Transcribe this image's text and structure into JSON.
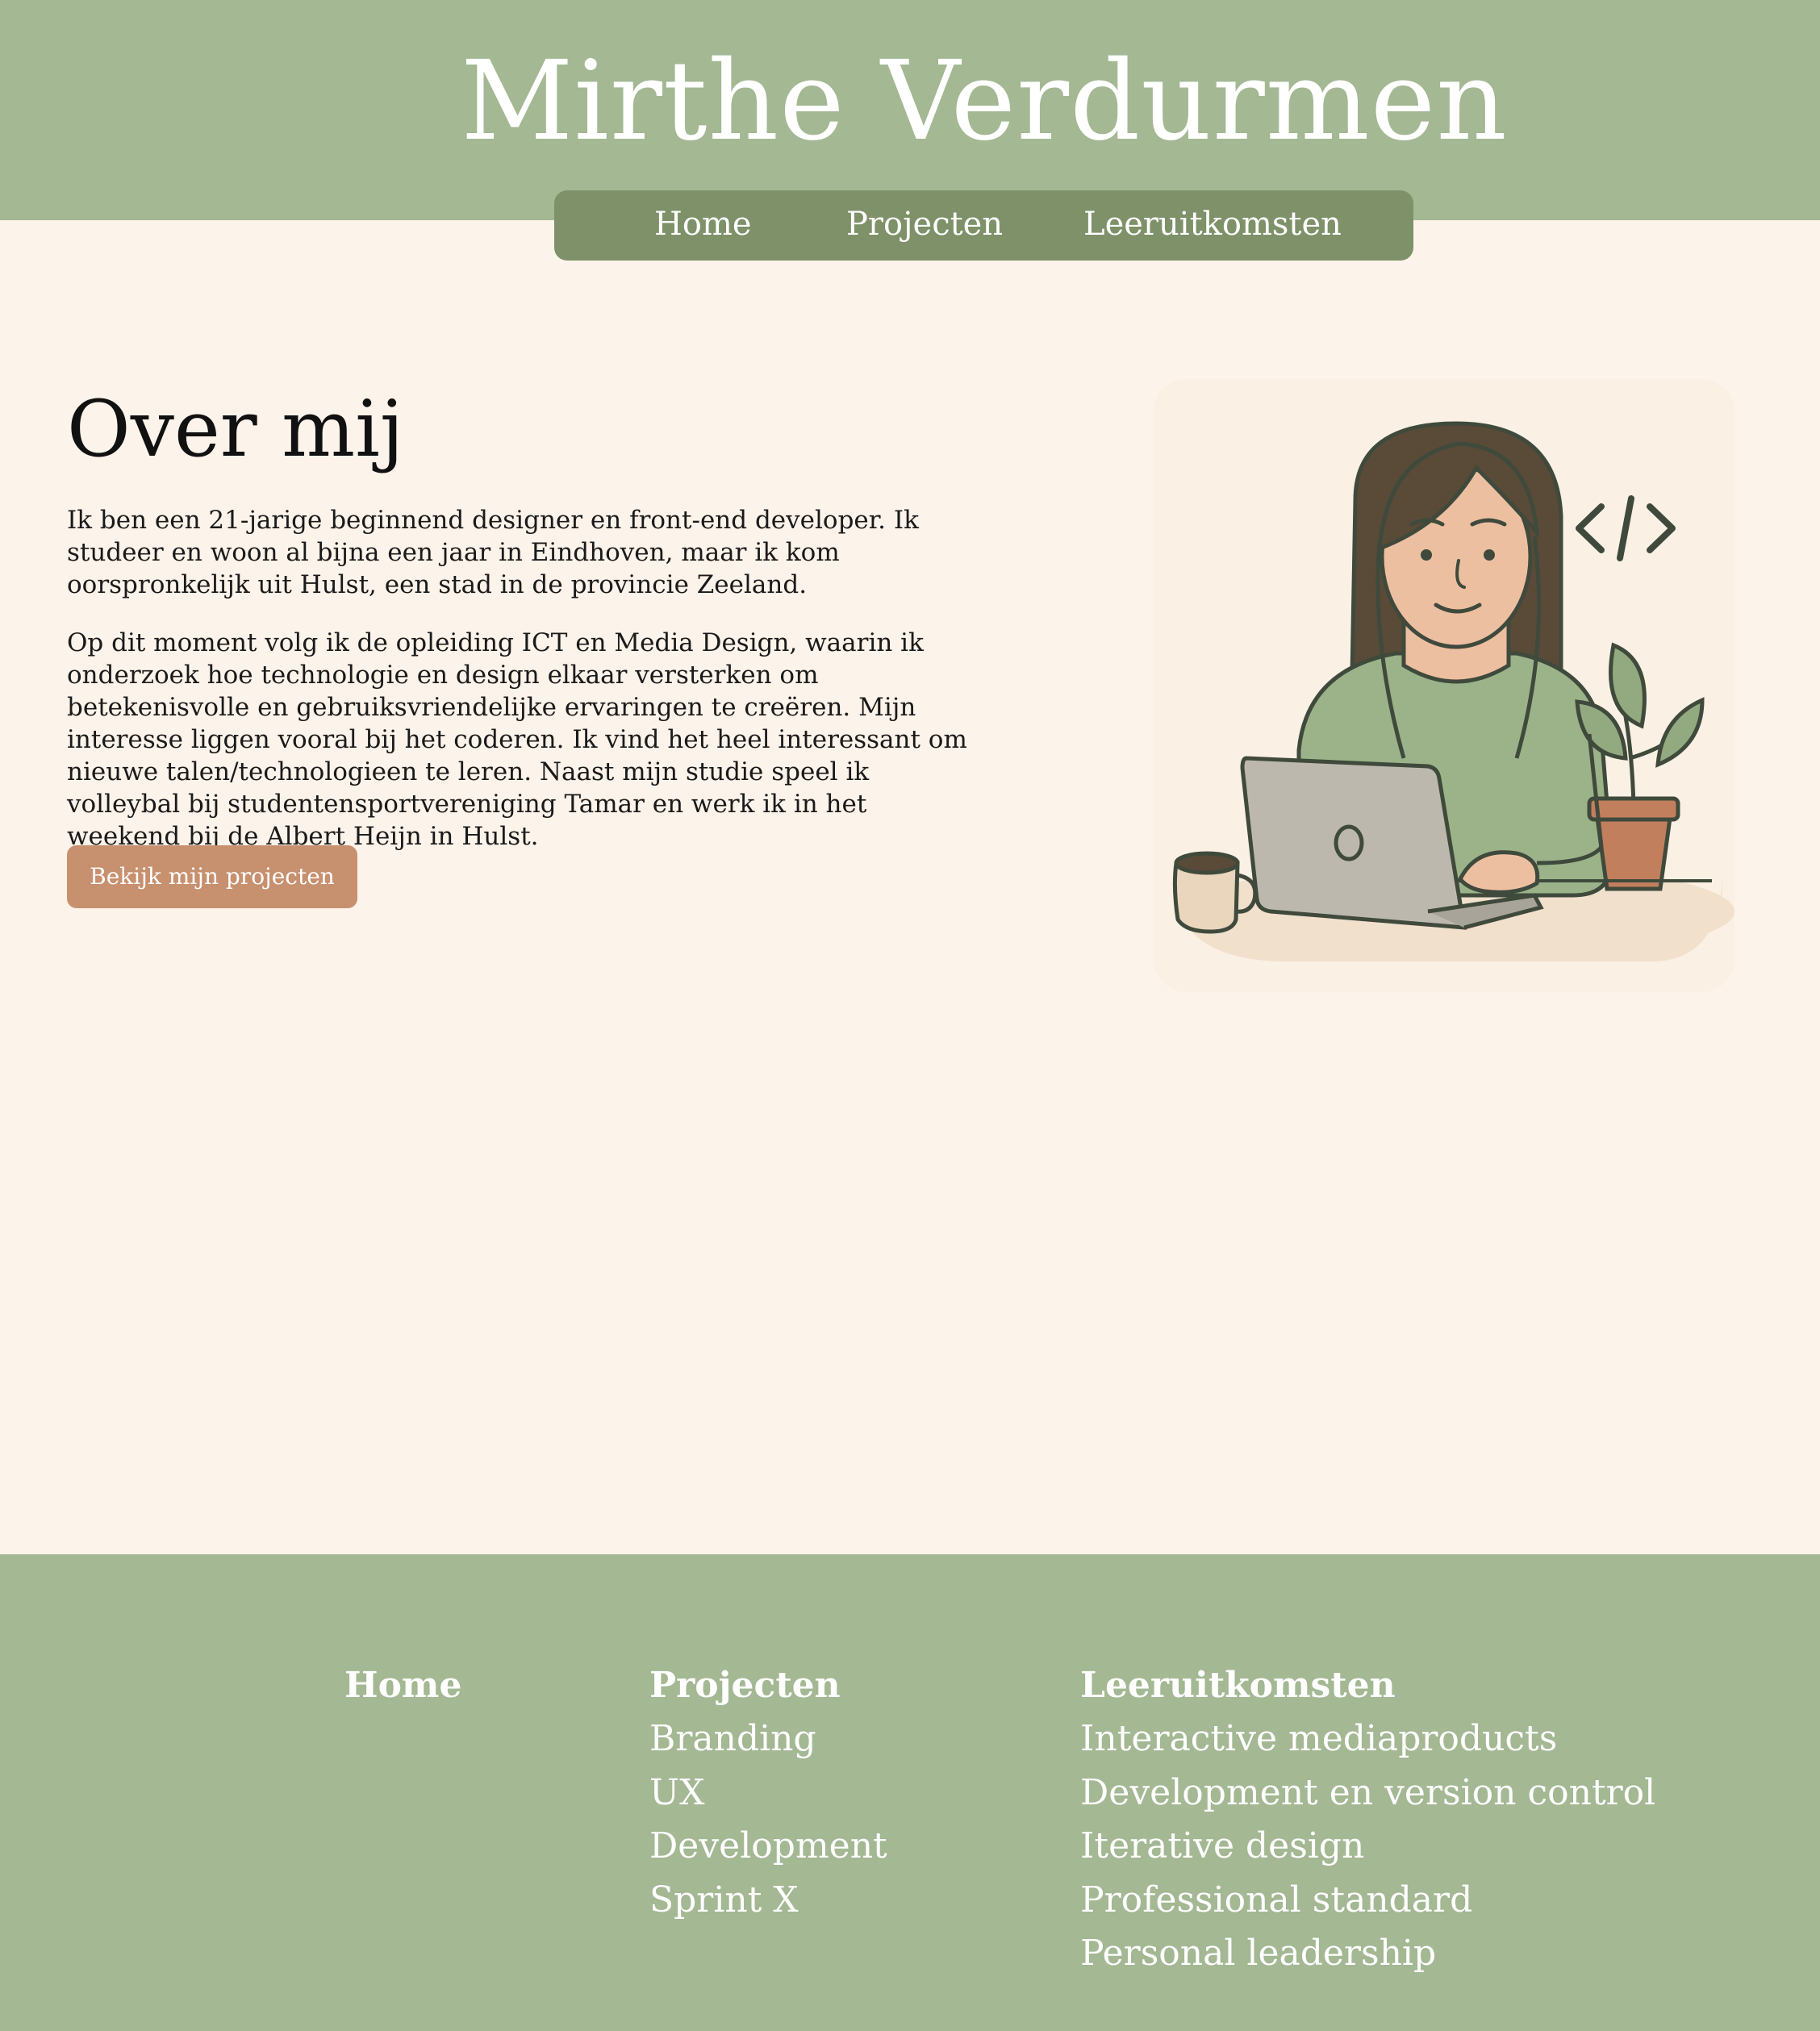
{
  "header": {
    "site_title": "Mirthe Verdurmen",
    "nav": [
      {
        "label": "Home"
      },
      {
        "label": "Projecten"
      },
      {
        "label": "Leeruitkomsten"
      }
    ]
  },
  "main": {
    "title": "Over mij",
    "paragraph_1": "Ik ben een 21-jarige beginnend designer en front-end developer. Ik studeer en woon al bijna een jaar in Eindhoven, maar ik kom oorspronkelijk uit Hulst, een stad in de provincie Zeeland.",
    "paragraph_2": "Op dit moment volg ik de opleiding ICT en Media Design, waarin ik onderzoek hoe technologie en design elkaar versterken om betekenisvolle en gebruiksvriendelijke ervaringen te creëren. Mijn interesse liggen vooral bij het coderen. Ik vind het heel interessant om nieuwe talen/technologieen te leren. Naast mijn studie speel ik volleybal bij studentensportvereniging Tamar en werk ik in het weekend bij de Albert Heijn in Hulst.",
    "cta_label": "Bekijk mijn projecten",
    "code_symbol": "</>"
  },
  "footer": {
    "home": {
      "heading": "Home"
    },
    "projecten": {
      "heading": "Projecten",
      "links": [
        "Branding",
        "UX",
        "Development",
        "Sprint X"
      ]
    },
    "leeruitkomsten": {
      "heading": "Leeruitkomsten",
      "links": [
        "Interactive mediaproducts",
        "Development en version control",
        "Iterative design",
        "Professional standard",
        "Personal leadership"
      ]
    }
  },
  "colors": {
    "header_bg": "#a3b893",
    "nav_bg": "#7e9169",
    "page_bg": "#fcf3ea",
    "button_bg": "#c7906e",
    "footer_bg": "#a3b893"
  },
  "icons": [
    "code-brackets-icon",
    "plant-icon",
    "coffee-mug-icon",
    "laptop-icon"
  ]
}
